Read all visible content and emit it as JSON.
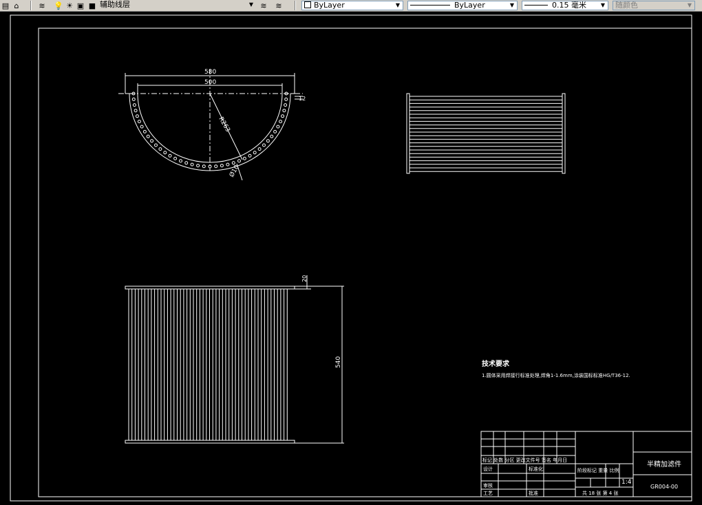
{
  "toolbar": {
    "layer_name": "辅助线层",
    "color": "ByLayer",
    "linetype": "ByLayer",
    "lineweight": "0.15 毫米",
    "plot_style": "随颜色"
  },
  "drawing": {
    "top_view": {
      "dim_outer": "580",
      "dim_inner": "500",
      "dim_radius": "R263",
      "dim_hole": "Ø10",
      "dim_offset": "12"
    },
    "front_view": {
      "dim_height": "540",
      "dim_flange": "20"
    },
    "tech_requirements": {
      "title": "技术要求",
      "line1": "1.圆体采用焊接行标准处理,焊角1-1.6mm,涂装国标标准HG/T36-12."
    },
    "title_block": {
      "part_name": "半精加滤件",
      "drawing_no": "GR004-00",
      "scale": "1:4",
      "header_row": "标记 处数 分区 更改文件号 签名 年月日",
      "designer": "设计",
      "standardize": "标准化",
      "reviewer": "审核",
      "process": "工艺",
      "approve": "批准",
      "stage_labels": "阶段标记  重量  比例",
      "sheet_info": "共 18 张  第 4 张"
    }
  }
}
